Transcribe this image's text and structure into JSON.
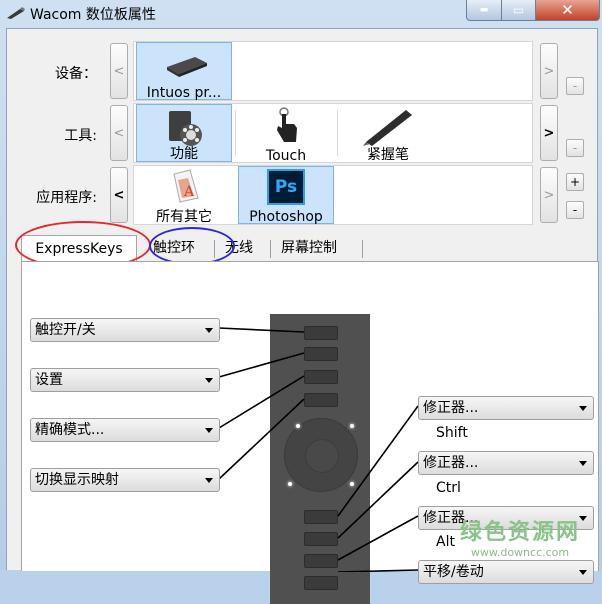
{
  "window": {
    "title": "Wacom 数位板属性",
    "min_glyph": "▬",
    "max_glyph": "▭",
    "close_glyph": "✕"
  },
  "rows": {
    "device": {
      "label": "设备：",
      "items": [
        {
          "label": "Intuos pr..."
        }
      ],
      "prev": "<",
      "next": ">",
      "remove": "-"
    },
    "tool": {
      "label": "工具:",
      "items": [
        {
          "label": "功能"
        },
        {
          "label": "Touch"
        },
        {
          "label": "紧握笔"
        }
      ],
      "prev": "<",
      "next": ">",
      "remove": "-"
    },
    "app": {
      "label": "应用程序:",
      "items": [
        {
          "label": "所有其它"
        },
        {
          "label": "Photoshop",
          "icon_text": "Ps"
        }
      ],
      "prev": "<",
      "next": ">",
      "add": "+",
      "remove": "-"
    }
  },
  "tabs": [
    {
      "label": "ExpressKeys"
    },
    {
      "label": "触控环"
    },
    {
      "label": "无线"
    },
    {
      "label": "屏幕控制"
    }
  ],
  "left_dropdowns": [
    {
      "value": "触控开/关"
    },
    {
      "value": "设置"
    },
    {
      "value": "精确模式..."
    },
    {
      "value": "切换显示映射"
    }
  ],
  "right_dropdowns": [
    {
      "value": "修正器...",
      "sub": "Shift"
    },
    {
      "value": "修正器...",
      "sub": "Ctrl"
    },
    {
      "value": "修正器...",
      "sub": "Alt"
    },
    {
      "value": "平移/卷动"
    }
  ],
  "colors": {
    "tab_circle_red": "#e8262a",
    "tab_circle_blue": "#2b2bd6",
    "selected_item": "#cce4fb"
  },
  "watermark": {
    "line1": "绿色资源网",
    "line2": "www.downcc.com"
  }
}
